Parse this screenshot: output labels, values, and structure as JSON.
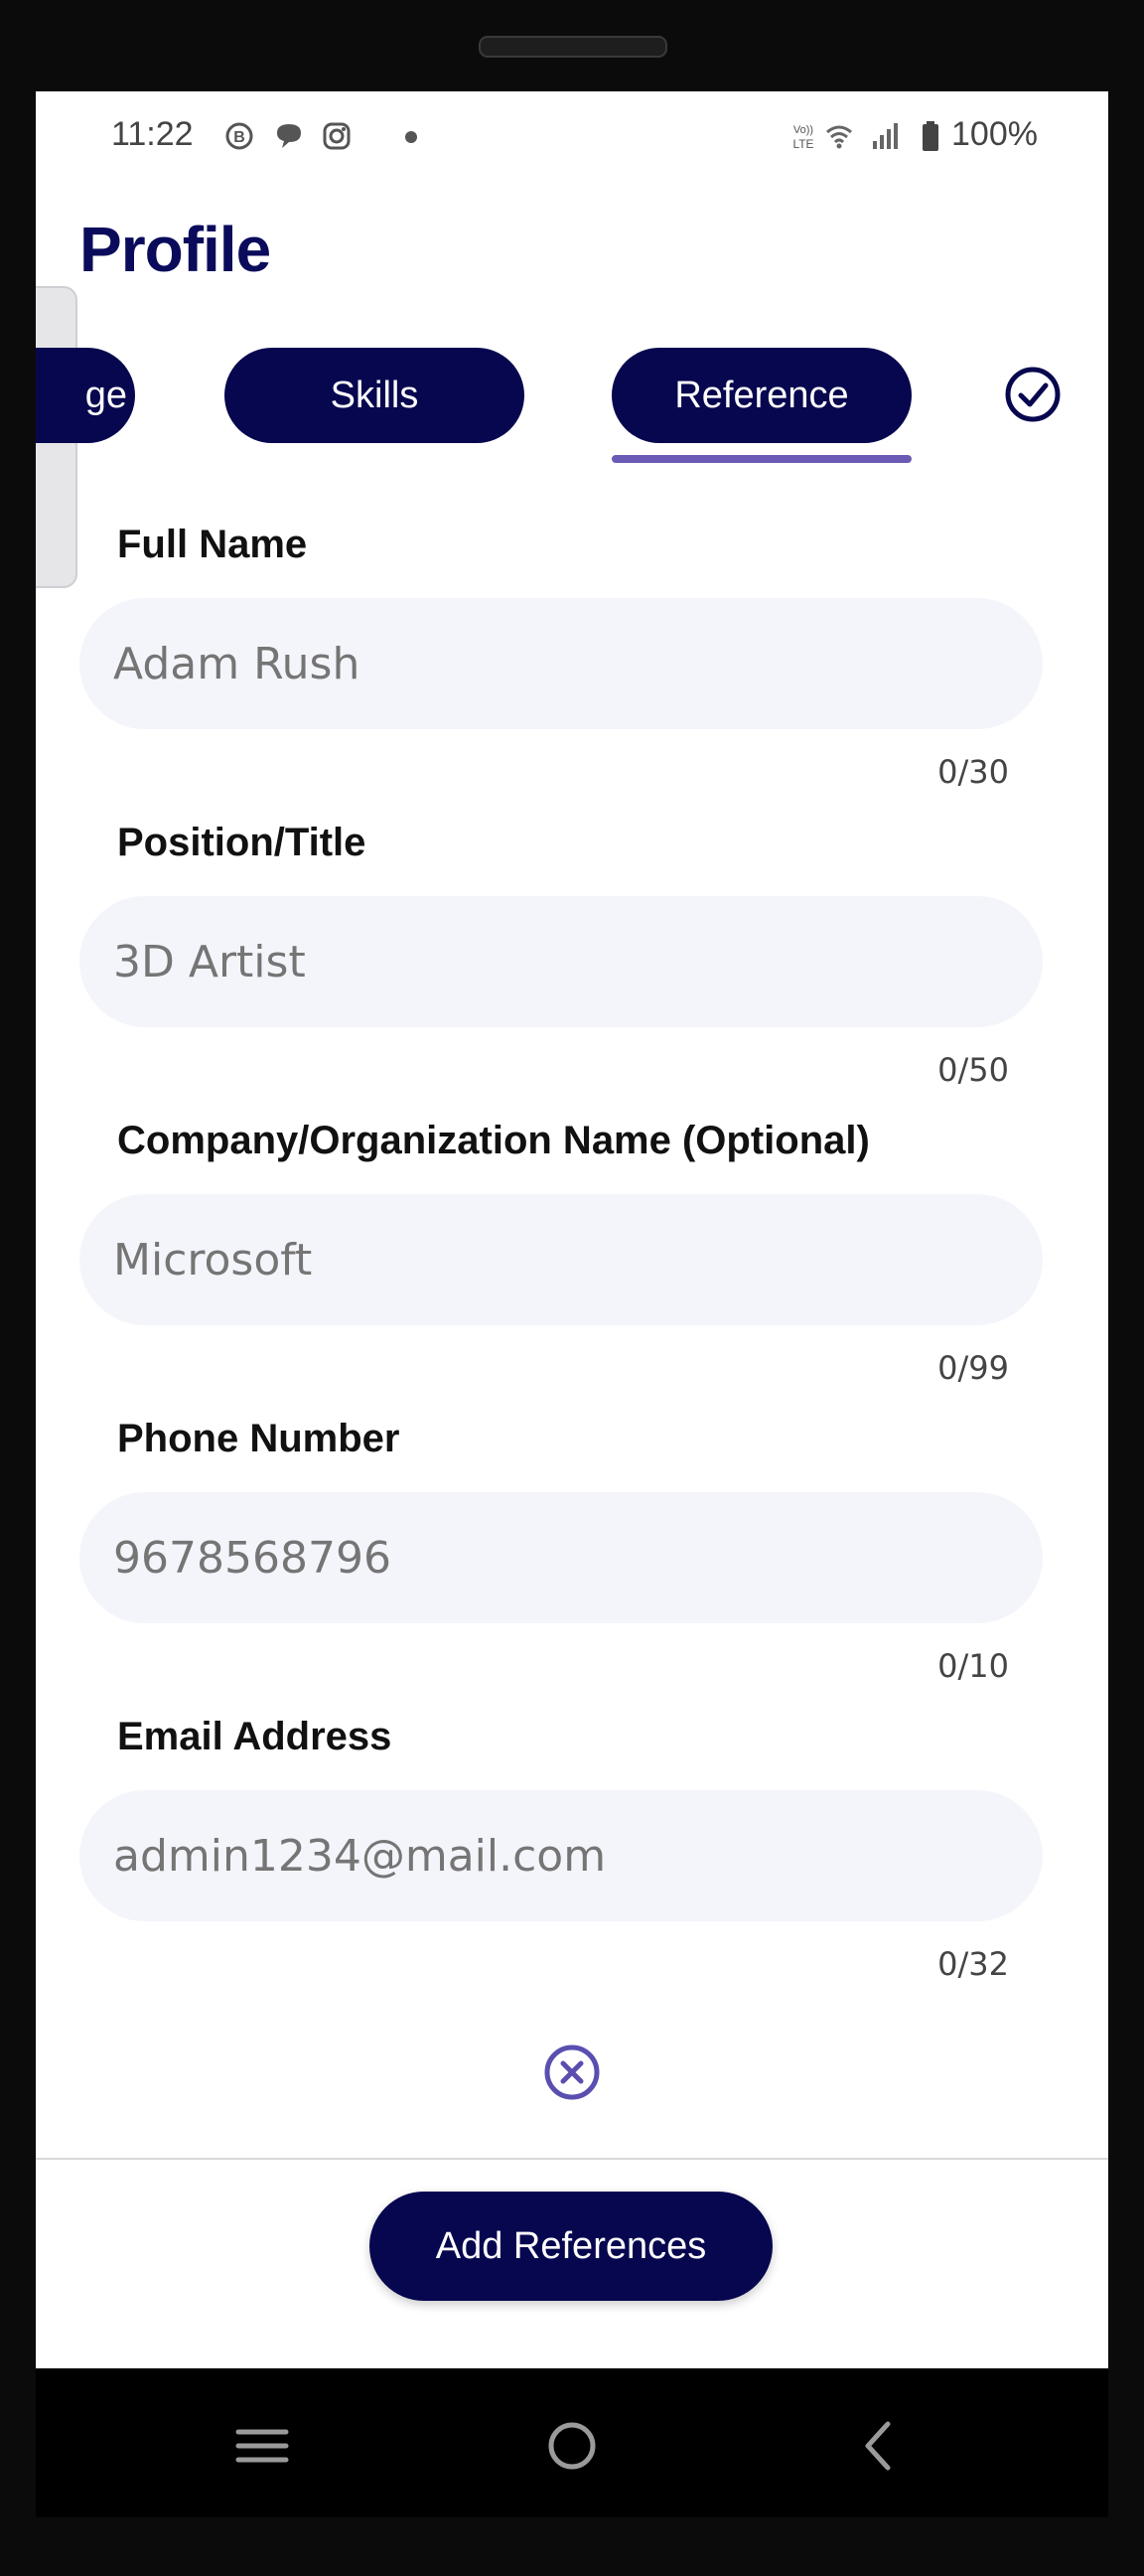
{
  "status_bar": {
    "time": "11:22",
    "battery": "100%",
    "icons": [
      "b-notification-icon",
      "chat-bubble-icon",
      "instagram-icon",
      "dot-icon",
      "volte-icon",
      "wifi-icon",
      "signal-icon",
      "battery-icon"
    ]
  },
  "header": {
    "title": "Profile"
  },
  "tabs": [
    {
      "label": "ge",
      "selected": false
    },
    {
      "label": "Skills",
      "selected": false
    },
    {
      "label": "Reference",
      "selected": true
    }
  ],
  "form": {
    "full_name": {
      "label": "Full Name",
      "placeholder": "Adam Rush",
      "counter": "0/30"
    },
    "position": {
      "label": "Position/Title",
      "placeholder": "3D Artist",
      "counter": "0/50"
    },
    "company": {
      "label": "Company/Organization Name (Optional)",
      "placeholder": "Microsoft",
      "counter": "0/99"
    },
    "phone": {
      "label": "Phone Number",
      "placeholder": "9678568796",
      "counter": "0/10"
    },
    "email": {
      "label": "Email Address",
      "placeholder": "admin1234@mail.com",
      "counter": "0/32"
    }
  },
  "footer": {
    "add_button": "Add References"
  },
  "colors": {
    "primary": "#07074f",
    "title": "#0b0b5c",
    "accent": "#6b5bb5",
    "field_bg": "#f4f5fb"
  }
}
